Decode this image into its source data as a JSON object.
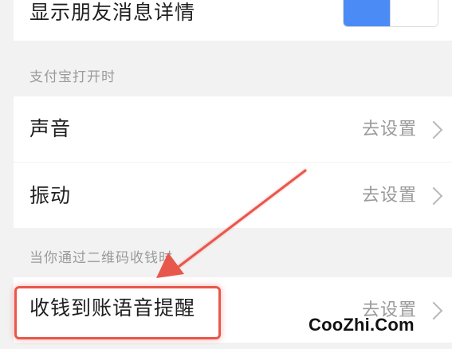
{
  "settings": {
    "show_friend_message_details": {
      "label": "显示朋友消息详情",
      "enabled": true
    },
    "alipay_open_section": {
      "header": "支付宝打开时",
      "items": [
        {
          "label": "声音",
          "value": "去设置"
        },
        {
          "label": "振动",
          "value": "去设置"
        }
      ]
    },
    "qr_receive_section": {
      "header": "当你通过二维码收钱时",
      "items": [
        {
          "label": "收钱到账语音提醒",
          "value": "去设置"
        }
      ]
    }
  },
  "watermark": {
    "text": "CooZhi.Com"
  },
  "annotation": {
    "arrow_color": "#e8574b",
    "highlight_color": "#e8574b"
  },
  "colors": {
    "background": "#f2f2f2",
    "row_background": "#ffffff",
    "primary_text": "#1f1f1f",
    "secondary_text": "#9a9a9a",
    "toggle_on": "#4b8bf5"
  },
  "icons": [
    "chevron-right-icon",
    "annotation-arrow-icon"
  ]
}
